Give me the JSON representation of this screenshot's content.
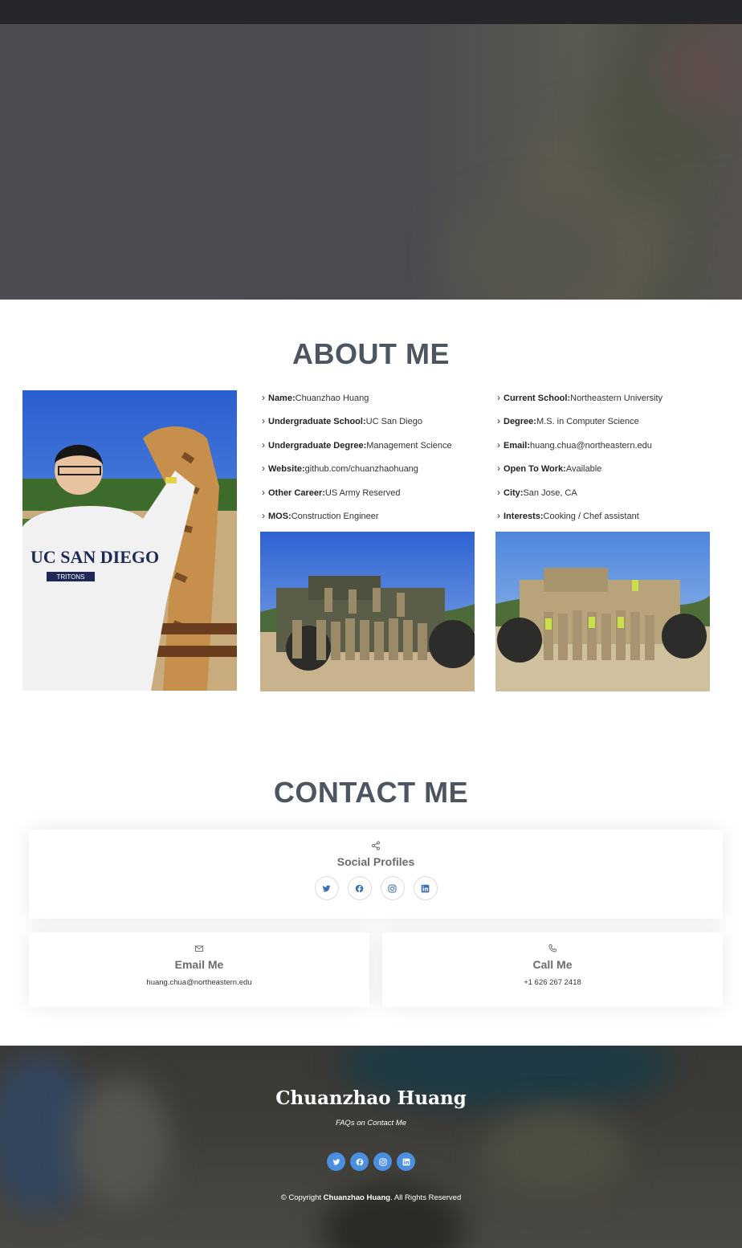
{
  "about": {
    "title": "ABOUT ME",
    "left_items": [
      {
        "label": "Name:",
        "value": "Chuanzhao Huang"
      },
      {
        "label": "Undergraduate School:",
        "value": "UC San Diego"
      },
      {
        "label": "Undergraduate Degree:",
        "value": "Management Science"
      },
      {
        "label": "Website:",
        "value": "github.com/chuanzhaohuang"
      },
      {
        "label": "Other Career:",
        "value": "US Army Reserved"
      },
      {
        "label": "MOS:",
        "value": "Construction Engineer"
      }
    ],
    "right_items": [
      {
        "label": "Current School:",
        "value": "Northeastern University"
      },
      {
        "label": "Degree:",
        "value": "M.S. in Computer Science"
      },
      {
        "label": "Email:",
        "value": "huang.chua@northeastern.edu"
      },
      {
        "label": "Open To Work:",
        "value": "Available"
      },
      {
        "label": "City:",
        "value": "San Jose, CA"
      },
      {
        "label": "Interests:",
        "value": "Cooking / Chef assistant"
      }
    ],
    "photo_sweatshirt_text": "UC SAN DIEGO",
    "photo_sweatshirt_subtext": "TRITONS"
  },
  "contact": {
    "title": "CONTACT ME",
    "social_title": "Social Profiles",
    "social_icons": [
      "twitter-icon",
      "facebook-icon",
      "instagram-icon",
      "linkedin-icon"
    ],
    "email_title": "Email Me",
    "email_value": "huang.chua@northeastern.edu",
    "call_title": "Call Me",
    "call_value": "+1 626 267 2418"
  },
  "footer": {
    "name": "Chuanzhao Huang",
    "faq": "FAQs on Contact Me",
    "copyright_prefix": "© Copyright ",
    "copyright_name": "Chuanzhao Huang",
    "copyright_suffix": ". All Rights Reserved"
  },
  "colors": {
    "heading": "#4d5560",
    "topbar": "#24262a",
    "social_accent": "#4a8fe0"
  }
}
